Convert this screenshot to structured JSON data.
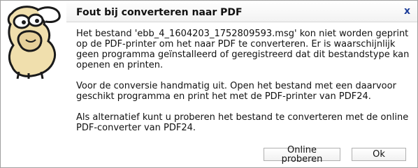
{
  "dialog": {
    "title": "Fout bij converteren naar PDF",
    "close_label": "x"
  },
  "message": {
    "paragraph1": "Het bestand 'ebb_4_1604203_1752809593.msg' kon niet worden geprint op de PDF-printer om het naar PDF te converteren. Er is waarschijnlijk geen programma geïnstalleerd of geregistreerd dat dit bestandstype kan openen en printen.",
    "paragraph2": "Voor de conversie handmatig uit. Open het bestand met een daarvoor geschikt programma en print het met de PDF-printer van PDF24.",
    "paragraph3": "Als alternatief kunt u proberen het bestand te converteren met de online PDF-converter van PDF24."
  },
  "buttons": {
    "online_label": "Online proberen",
    "ok_label": "Ok"
  },
  "colors": {
    "close": "#1f3f9a",
    "border": "#a0a0a0"
  },
  "icons": {
    "logo": "pdf24-sheep-logo"
  }
}
